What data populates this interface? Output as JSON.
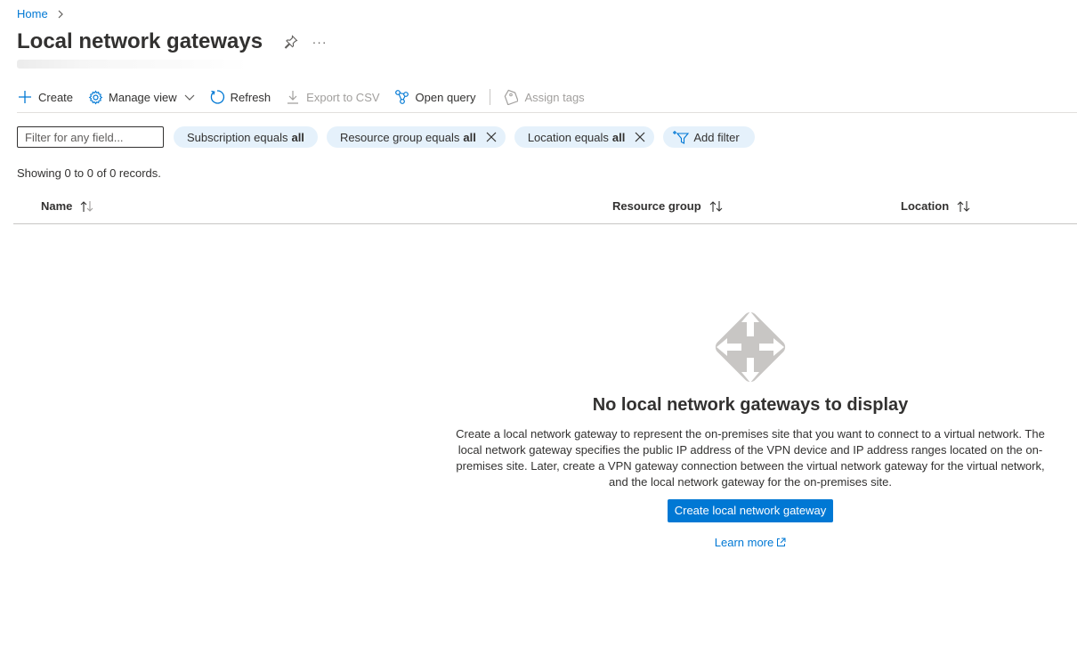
{
  "breadcrumb": {
    "home": "Home"
  },
  "header": {
    "title": "Local network gateways",
    "more": "···"
  },
  "toolbar": {
    "create": "Create",
    "manage_view": "Manage view",
    "refresh": "Refresh",
    "export_csv": "Export to CSV",
    "open_query": "Open query",
    "assign_tags": "Assign tags"
  },
  "filters": {
    "placeholder": "Filter for any field...",
    "subscription_prefix": "Subscription equals",
    "subscription_value": "all",
    "resource_group_prefix": "Resource group equals",
    "resource_group_value": "all",
    "location_prefix": "Location equals",
    "location_value": "all",
    "add_filter": "Add filter"
  },
  "records": "Showing 0 to 0 of 0 records.",
  "table": {
    "columns": [
      "Name",
      "Resource group",
      "Location"
    ]
  },
  "empty_state": {
    "title": "No local network gateways to display",
    "description": "Create a local network gateway to represent the on-premises site that you want to connect to a virtual network. The local network gateway specifies the public IP address of the VPN device and IP address ranges located on the on-premises site. Later, create a VPN gateway connection between the virtual network gateway for the virtual network, and the local network gateway for the on-premises site.",
    "button": "Create local network gateway",
    "learn_more": "Learn more"
  },
  "colors": {
    "accent": "#0078d4",
    "pill_bg": "#e5f1fb",
    "text": "#323130",
    "disabled": "#a19f9d"
  }
}
